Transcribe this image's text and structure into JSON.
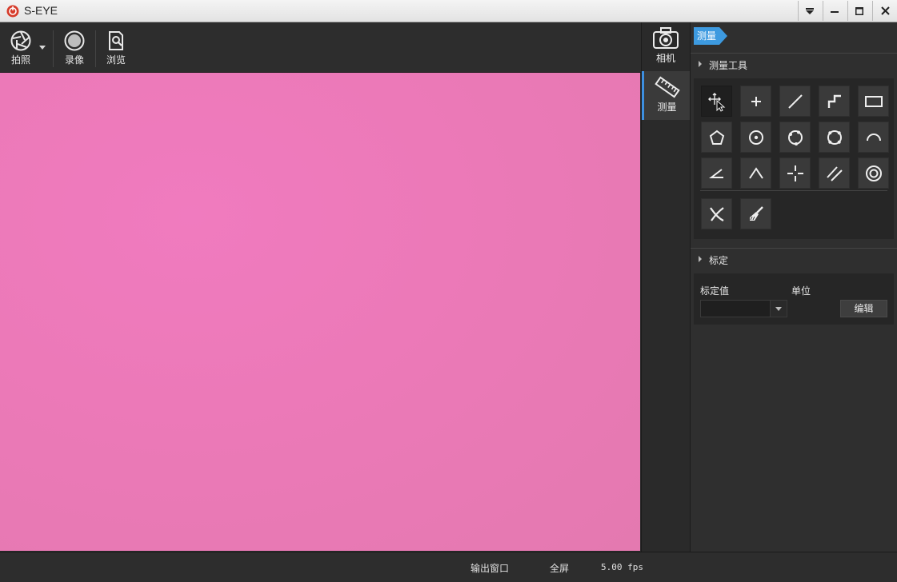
{
  "window": {
    "title": "S-EYE",
    "controls": [
      "dropdown-icon",
      "minimize-icon",
      "maximize-icon",
      "close-icon"
    ]
  },
  "toolbar": {
    "capture_label": "拍照",
    "record_label": "录像",
    "browse_label": "浏览"
  },
  "side_nav": {
    "camera_label": "相机",
    "measure_label": "测量"
  },
  "panel": {
    "tab_label": "测量",
    "measure_tools_title": "测量工具",
    "tools": [
      "move-cursor-icon",
      "point-icon",
      "line-icon",
      "polyline-icon",
      "rectangle-icon",
      "polygon-icon",
      "circle-center-icon",
      "three-point-circle-icon",
      "four-point-circle-icon",
      "arc-icon",
      "angle-icon",
      "three-point-angle-icon",
      "crosshair-icon",
      "parallel-lines-icon",
      "concentric-circles-icon",
      "delete-icon",
      "clear-brush-icon"
    ],
    "calibration_title": "标定",
    "calibration_value_label": "标定值",
    "calibration_unit_label": "单位",
    "calibration_value": "",
    "edit_label": "编辑"
  },
  "status": {
    "output_window_label": "输出窗口",
    "fullscreen_label": "全屏",
    "fps": "5.00 fps"
  },
  "colors": {
    "preview": "#ec79b8",
    "accent": "#3d9ae0",
    "logo": "#d63b2a"
  }
}
